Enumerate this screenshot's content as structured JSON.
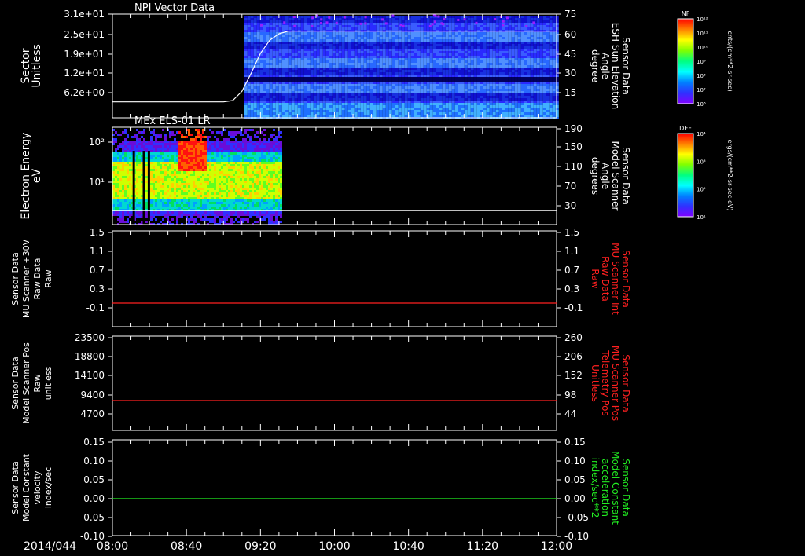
{
  "date_label": "2014/044",
  "time_ticks": [
    "08:00",
    "08:40",
    "09:20",
    "10:00",
    "10:40",
    "11:20",
    "12:00"
  ],
  "colorbar1": {
    "title": "NF",
    "ticks": [
      "10¹²",
      "10¹¹",
      "10¹⁰",
      "10⁹",
      "10⁸",
      "10⁷",
      "10⁶"
    ],
    "unit": "cnts/(cm**2-sr-sec)"
  },
  "colorbar2": {
    "title": "DEF",
    "ticks": [
      "10⁴",
      "10³",
      "10²",
      "10¹"
    ],
    "unit": "ergs/(cm**2-sr-sec-eV)"
  },
  "chart_data": [
    {
      "type": "heatmap",
      "title": "NPI Vector Data",
      "left_label": [
        "Sector",
        "Unitless"
      ],
      "left_ticks": [
        "3.1e+01",
        "2.5e+01",
        "1.9e+01",
        "1.2e+01",
        "6.2e+00"
      ],
      "right_label": [
        "Sensor Data",
        "ESH Sun Elevation",
        "Angle",
        "degree"
      ],
      "right_label_color": "#ffffff",
      "right_ticks": [
        "75",
        "60",
        "45",
        "30",
        "15"
      ],
      "overlay_line": {
        "x": [
          "08:00",
          "09:00",
          "09:05",
          "09:10",
          "09:15",
          "09:20",
          "09:25",
          "09:30",
          "09:35",
          "12:00"
        ],
        "y": [
          8,
          8,
          9,
          16,
          30,
          45,
          55,
          60,
          62,
          62
        ]
      }
    },
    {
      "type": "heatmap",
      "title": "MEx ELS-01 LR",
      "left_label": [
        "Electron Energy",
        "eV"
      ],
      "left_ticks": [
        "10²",
        "10¹"
      ],
      "right_label": [
        "Sensor Data",
        "Model Scanner",
        "Angle",
        "degrees"
      ],
      "right_label_color": "#ffffff",
      "right_ticks": [
        "190",
        "150",
        "110",
        "70",
        "30"
      ],
      "overlay_line": {
        "x": [
          "08:00",
          "12:00"
        ],
        "y": [
          20,
          20
        ]
      }
    },
    {
      "type": "line",
      "left_label": [
        "Sensor Data",
        "MU Scanner +30V",
        "Raw Data",
        "Raw"
      ],
      "left_ticks": [
        "1.5",
        "1.1",
        "0.7",
        "0.3",
        "-0.1"
      ],
      "right_label": [
        "Sensor Data",
        "MU Scanner Int",
        "Raw Data",
        "Raw"
      ],
      "right_label_color": "#ff2020",
      "right_ticks": [
        "1.5",
        "1.1",
        "0.7",
        "0.3",
        "-0.1"
      ],
      "ylim": [
        -0.3,
        1.5
      ],
      "series": [
        {
          "color": "#ff2020",
          "x": [
            "08:00",
            "12:00"
          ],
          "y": [
            0,
            0
          ]
        }
      ]
    },
    {
      "type": "line",
      "left_label": [
        "Sensor Data",
        "Model Scanner Pos",
        "Raw",
        "unitless"
      ],
      "left_ticks": [
        "23500",
        "18800",
        "14100",
        "9400",
        "4700"
      ],
      "right_label": [
        "Sensor Data",
        "MU Scanner Pos",
        "Telemetry Pos",
        "Unitless"
      ],
      "right_label_color": "#ff2020",
      "right_ticks": [
        "260",
        "206",
        "152",
        "98",
        "44"
      ],
      "ylim": [
        0,
        23500
      ],
      "series": [
        {
          "color": "#ff2020",
          "x": [
            "08:00",
            "12:00"
          ],
          "y": [
            8000,
            8000
          ]
        }
      ]
    },
    {
      "type": "line",
      "left_label": [
        "Sensor Data",
        "Model Constant",
        "velocity",
        "index/sec"
      ],
      "left_ticks": [
        "0.15",
        "0.10",
        "0.05",
        "0.00",
        "-0.05",
        "-0.10"
      ],
      "right_label": [
        "Sensor Data",
        "Model Constant",
        "acceleration",
        "index/sec**2"
      ],
      "right_label_color": "#22ee22",
      "right_ticks": [
        "0.15",
        "0.10",
        "0.05",
        "0.00",
        "-0.05",
        "-0.10"
      ],
      "ylim": [
        -0.1,
        0.15
      ],
      "series": [
        {
          "color": "#22ee22",
          "x": [
            "08:00",
            "12:00"
          ],
          "y": [
            0,
            0
          ]
        }
      ]
    }
  ]
}
